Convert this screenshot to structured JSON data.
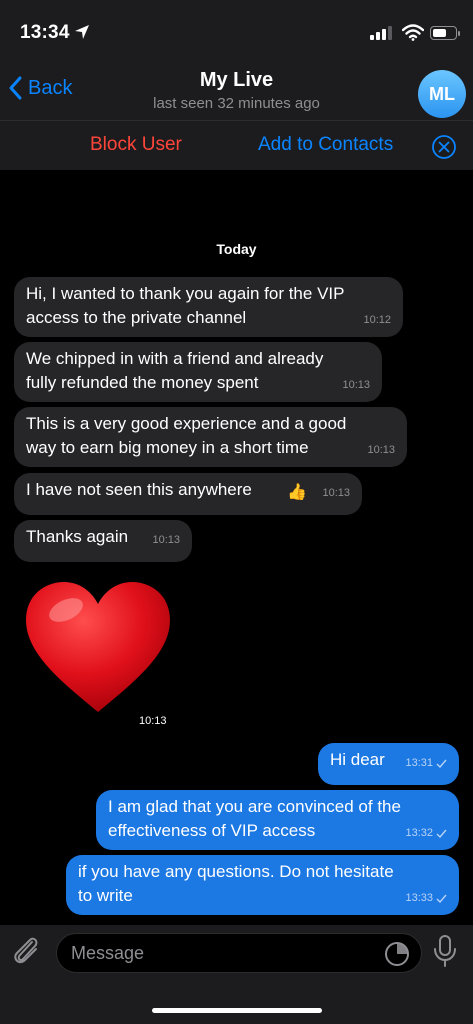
{
  "status": {
    "time": "13:34"
  },
  "header": {
    "back_label": "Back",
    "title": "My Live",
    "subtitle": "last seen 32 minutes ago",
    "avatar_initials": "ML"
  },
  "actions": {
    "block_label": "Block User",
    "add_label": "Add to Contacts"
  },
  "chat": {
    "date_label": "Today",
    "messages": [
      {
        "direction": "in",
        "text": "Hi, I wanted to thank you again for the VIP\naccess to the private channel",
        "time": "10:12"
      },
      {
        "direction": "in",
        "text": "We chipped in with a friend and already\nfully refunded the money spent",
        "time": "10:13"
      },
      {
        "direction": "in",
        "text": "This is a very good experience and a good\nway to earn big money in a short time",
        "time": "10:13"
      },
      {
        "direction": "in",
        "text": "I have not seen this anywhere",
        "emoji": "👍",
        "time": "10:13"
      },
      {
        "direction": "in",
        "text": "Thanks again",
        "time": "10:13"
      },
      {
        "direction": "in",
        "type": "sticker",
        "sticker": "red-heart",
        "time": "10:13"
      },
      {
        "direction": "out",
        "text": "Hi dear",
        "time": "13:31"
      },
      {
        "direction": "out",
        "text": "I am glad that you are convinced of the\neffectiveness of VIP access",
        "time": "13:32"
      },
      {
        "direction": "out",
        "text": "if you have any questions.  Do not hesitate\nto write",
        "time": "13:33"
      }
    ]
  },
  "input": {
    "placeholder": "Message"
  },
  "colors": {
    "accent": "#0a84ff",
    "danger": "#ff453a",
    "outgoing_bubble": "#1c78e3",
    "incoming_bubble": "#262628",
    "bar_background": "#1c1c1e"
  }
}
